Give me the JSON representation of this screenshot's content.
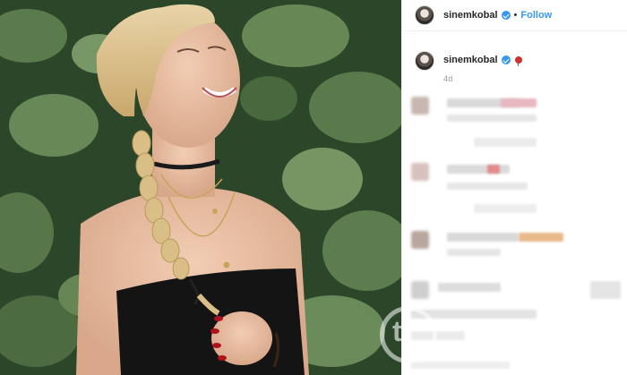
{
  "post": {
    "username": "sinemkobal",
    "follow_label": "Follow",
    "separator": "•",
    "time_ago": "4d"
  },
  "icons": {
    "verified": "verified-badge-icon",
    "caption_emoji": "balloon-emoji-icon",
    "watermark": "watermark-logo-icon"
  },
  "colors": {
    "link_blue": "#3897f0",
    "username": "#262626",
    "muted": "#999999"
  }
}
